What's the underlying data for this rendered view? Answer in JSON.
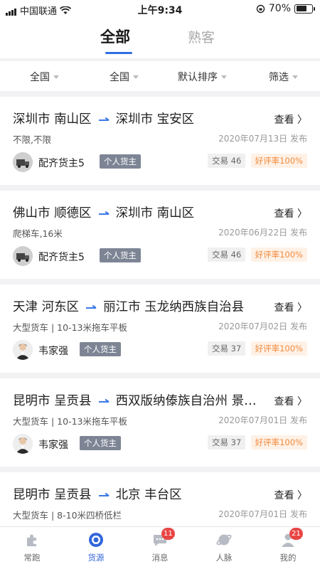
{
  "status_bar": {
    "carrier": "中国联通",
    "time": "上午9:34",
    "battery": "70%",
    "battery_level": 0.7
  },
  "tabs": [
    {
      "label": "全部",
      "active": true
    },
    {
      "label": "熟客",
      "active": false
    }
  ],
  "filters": [
    "全国",
    "全国",
    "默认排序",
    "筛选"
  ],
  "orders": [
    {
      "from": "深圳市 南山区",
      "to": "深圳市 宝安区",
      "vehicle": "不限,不限",
      "date": "2020年07月13日 发布",
      "shipper": "配齐货主5",
      "type": "个人货主",
      "deals": "交易 46",
      "praise": "好评率100%",
      "view": "查看 〉",
      "avatar": "truck"
    },
    {
      "from": "佛山市 顺德区",
      "to": "深圳市 南山区",
      "vehicle": "爬梯车,16米",
      "date": "2020年06月22日 发布",
      "shipper": "配齐货主5",
      "type": "个人货主",
      "deals": "交易 46",
      "praise": "好评率100%",
      "view": "查看 〉",
      "avatar": "truck"
    },
    {
      "from": "天津 河东区",
      "to": "丽江市 玉龙纳西族自治县",
      "vehicle": "大型货车 | 10-13米拖车平板",
      "date": "2020年07月02日 发布",
      "shipper": "韦家强",
      "type": "个人货主",
      "deals": "交易 37",
      "praise": "好评率100%",
      "view": "查看 〉",
      "avatar": "person"
    },
    {
      "from": "昆明市 呈贡县",
      "to": "西双版纳傣族自治州 景洪市",
      "vehicle": "大型货车 | 10-13米拖车平板",
      "date": "2020年07月01日 发布",
      "shipper": "韦家强",
      "type": "个人货主",
      "deals": "交易 37",
      "praise": "好评率100%",
      "view": "查看 〉",
      "avatar": "person"
    },
    {
      "from": "昆明市 呈贡县",
      "to": "北京 丰台区",
      "vehicle": "大型货车 | 8-10米四桥低栏",
      "date": "2020年07月01日 发布",
      "shipper": "",
      "type": "",
      "deals": "",
      "praise": "",
      "view": "查看 〉",
      "avatar": ""
    }
  ],
  "bottom_nav": [
    {
      "label": "常跑",
      "icon": "puzzle-icon",
      "active": false,
      "badge": ""
    },
    {
      "label": "货源",
      "icon": "target-icon",
      "active": true,
      "badge": ""
    },
    {
      "label": "消息",
      "icon": "chat-icon",
      "active": false,
      "badge": "11"
    },
    {
      "label": "人脉",
      "icon": "planet-icon",
      "active": false,
      "badge": ""
    },
    {
      "label": "我的",
      "icon": "user-icon",
      "active": false,
      "badge": "21"
    }
  ],
  "colors": {
    "accent": "#2f6fe0",
    "tag_bg": "#7d8595",
    "praise_text": "#f08a3c",
    "badge": "#e94545"
  }
}
